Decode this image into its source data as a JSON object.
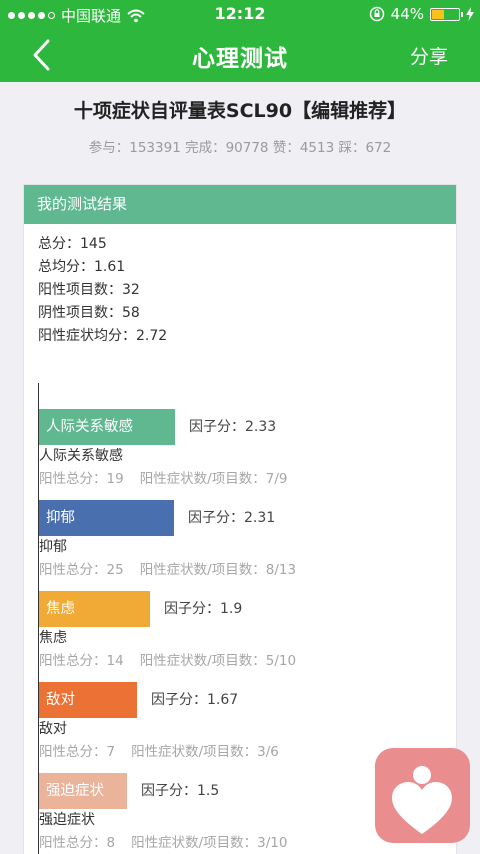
{
  "status": {
    "carrier": "中国联通",
    "time": "12:12",
    "battery": "44%"
  },
  "nav": {
    "title": "心理测试",
    "share": "分享"
  },
  "test_title": "十项症状自评量表SCL90【编辑推荐】",
  "stats_line": "参与：153391 完成：90778 赞：4513 踩：672",
  "card_title": "我的测试结果",
  "summary": [
    "总分：145",
    "总均分：1.61",
    "阳性项目数：32",
    "阴性项目数：58",
    "阳性症状均分：2.72"
  ],
  "score_label": "因子分：",
  "factors": [
    {
      "name": "人际关系敏感",
      "score": "2.33",
      "value": 2.33,
      "color": "#5fb890",
      "positive_total": "阳性总分：19",
      "ratio": "阳性症状数/项目数：7/9"
    },
    {
      "name": "抑郁",
      "score": "2.31",
      "value": 2.31,
      "color": "#4a6fae",
      "positive_total": "阳性总分：25",
      "ratio": "阳性症状数/项目数：8/13"
    },
    {
      "name": "焦虑",
      "score": "1.9",
      "value": 1.9,
      "color": "#f0aa35",
      "positive_total": "阳性总分：14",
      "ratio": "阳性症状数/项目数：5/10"
    },
    {
      "name": "敌对",
      "score": "1.67",
      "value": 1.67,
      "color": "#ec7135",
      "positive_total": "阳性总分：7",
      "ratio": "阳性症状数/项目数：3/6"
    },
    {
      "name": "强迫症状",
      "score": "1.5",
      "value": 1.5,
      "color": "#ebb39a",
      "positive_total": "阳性总分：8",
      "ratio": "阳性症状数/项目数：3/10"
    }
  ]
}
